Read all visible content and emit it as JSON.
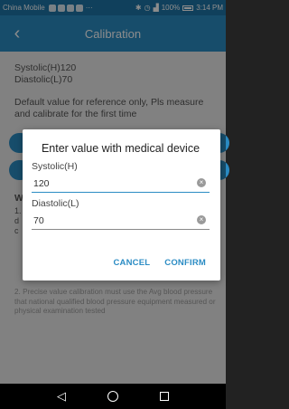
{
  "status_bar": {
    "carrier": "China Mobile",
    "ellipsis": "···",
    "signal_text": "100%",
    "time": "3:14 PM"
  },
  "app_bar": {
    "back_glyph": "‹",
    "title": "Calibration"
  },
  "content": {
    "systolic_line": "Systolic(H)120",
    "diastolic_line": "Diastolic(L)70",
    "note": "Default value for reference only, Pls measure and calibrate for the first time",
    "warn_title": "W",
    "warn_line1": "1. A",
    "warn_line2": "d",
    "warn_line3": "c",
    "warn_tail": "2. Precise value calibration must use the Avg blood pressure that national qualified blood pressure equipment measured or physical examination tested"
  },
  "dialog": {
    "title": "Enter value with medical device",
    "systolic_label": "Systolic(H)",
    "systolic_value": "120",
    "diastolic_label": "Diastolic(L)",
    "diastolic_value": "70",
    "clear_glyph": "×",
    "cancel_label": "CANCEL",
    "confirm_label": "CONFIRM"
  },
  "nav_bar": {
    "back_glyph": "◁"
  },
  "colors": {
    "primary": "#2b8cc4",
    "status_bar": "#1e76a8"
  }
}
